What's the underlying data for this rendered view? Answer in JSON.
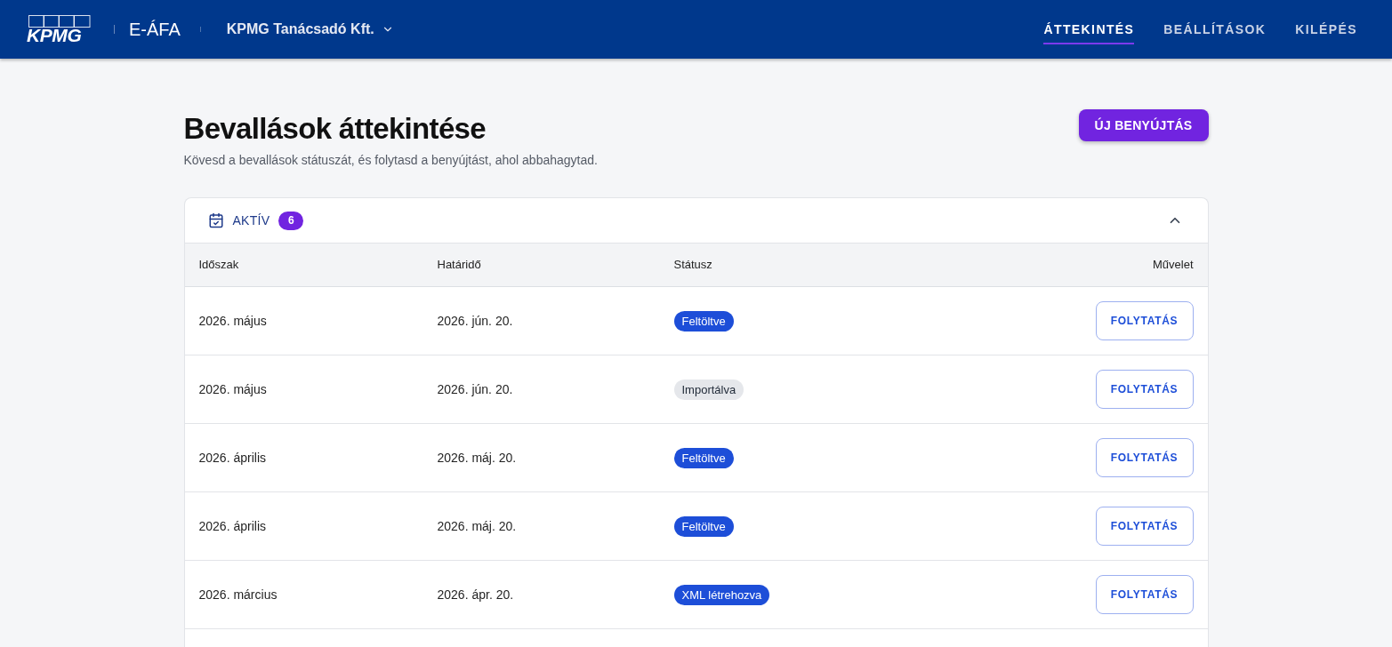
{
  "header": {
    "logo": "KPMG",
    "app_name": "E-ÁFA",
    "company": "KPMG Tanácsadó Kft.",
    "nav": [
      {
        "label": "ÁTTEKINTÉS",
        "selected": true
      },
      {
        "label": "BEÁLLÍTÁSOK",
        "selected": false
      },
      {
        "label": "KILÉPÉS",
        "selected": false
      }
    ]
  },
  "page": {
    "title": "Bevallások áttekintése",
    "subtitle": "Kövesd a bevallások státuszát, és folytasd a benyújtást, ahol abbahagytad.",
    "new_button": "ÚJ BENYÚJTÁS"
  },
  "section": {
    "label": "AKTÍV",
    "count": "6",
    "expanded": true
  },
  "table": {
    "columns": [
      "Időszak",
      "Határidő",
      "Státusz",
      "Művelet"
    ],
    "rows": [
      {
        "period": "2026. május",
        "deadline": "2026. jún. 20.",
        "status": {
          "label": "Feltöltve",
          "color": "#1d4ed8"
        },
        "action": "FOLYTATÁS"
      },
      {
        "period": "2026. május",
        "deadline": "2026. jún. 20.",
        "status": {
          "label": "Importálva",
          "color": "#e5e7eb"
        },
        "action": "FOLYTATÁS"
      },
      {
        "period": "2026. április",
        "deadline": "2026. máj. 20.",
        "status": {
          "label": "Feltöltve",
          "color": "#1d4ed8"
        },
        "action": "FOLYTATÁS"
      },
      {
        "period": "2026. április",
        "deadline": "2026. máj. 20.",
        "status": {
          "label": "Feltöltve",
          "color": "#1d4ed8"
        },
        "action": "FOLYTATÁS"
      },
      {
        "period": "2026. március",
        "deadline": "2026. ápr. 20.",
        "status": {
          "label": "XML létrehozva",
          "color": "#1d4ed8"
        },
        "action": "FOLYTATÁS"
      }
    ]
  }
}
